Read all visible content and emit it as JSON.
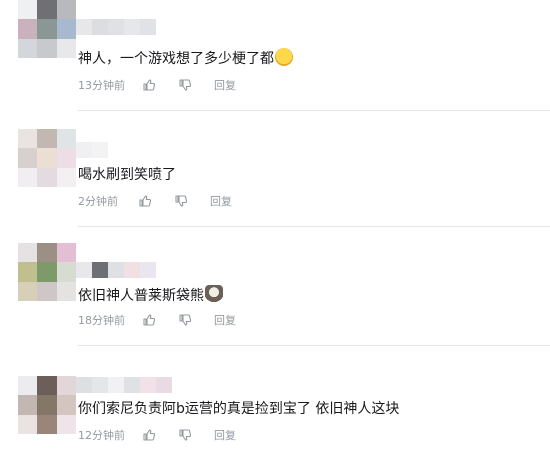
{
  "comments": [
    {
      "text": "神人，一个游戏想了多少梗了都",
      "time": "13分钟前",
      "reply_label": "回复",
      "emoji": "laughing-tears-emoji",
      "avatar_colors": [
        "#eff0f1",
        "#6f6f74",
        "#b7b9bd",
        "#c9b2bd",
        "#8a9794",
        "#a7b9cf",
        "#d3d6db",
        "#c8c9cc",
        "#e8e8ea"
      ],
      "name_colors": [
        "#e7e7ea",
        "#dcdde0",
        "#e0e1e4",
        "#e6e7ea",
        "#e1e2e5"
      ]
    },
    {
      "text": "喝水刷到笑喷了",
      "time": "2分钟前",
      "reply_label": "回复",
      "avatar_colors": [
        "#e9e4e2",
        "#c2b7b1",
        "#dfe4e7",
        "#d6d1cf",
        "#ebdfd5",
        "#efdde6",
        "#f0eef0",
        "#e3dbe0",
        "#f2f0f1"
      ],
      "name_colors": [
        "#f0f0f2",
        "#f3f3f4"
      ]
    },
    {
      "text": "依旧神人普莱斯袋熊",
      "time": "18分钟前",
      "reply_label": "回复",
      "emoji": "raccoon-sticker",
      "avatar_colors": [
        "#e6e1e3",
        "#9c8f86",
        "#e2bfd2",
        "#bfbf8f",
        "#7e9a6a",
        "#d6dcd2",
        "#d8cfb9",
        "#cfc6c8",
        "#e5e2e2"
      ],
      "name_colors": [
        "#e8e8ea",
        "#6d6f75",
        "#dfe0e3",
        "#f0dfe3",
        "#e9e6f0"
      ]
    },
    {
      "text": "你们索尼负责阿b运营的真是捡到宝了 依旧神人这块",
      "time": "12分钟前",
      "reply_label": "回复",
      "avatar_colors": [
        "#ececee",
        "#6c5e58",
        "#e2d6d8",
        "#c2b8b1",
        "#857767",
        "#d5c5c1",
        "#e9e3e2",
        "#9a857b",
        "#efe4ea"
      ],
      "name_colors": [
        "#dedfe3",
        "#e5e6e9",
        "#f1f1f3",
        "#e0e1e5",
        "#f3e1e8",
        "#e9dbe3"
      ]
    }
  ],
  "colors": {
    "text_primary": "#18191c",
    "text_secondary": "#9499a0",
    "divider": "#e3e5e7"
  },
  "icons": {
    "like": "thumb-up-icon",
    "dislike": "thumb-down-icon"
  }
}
